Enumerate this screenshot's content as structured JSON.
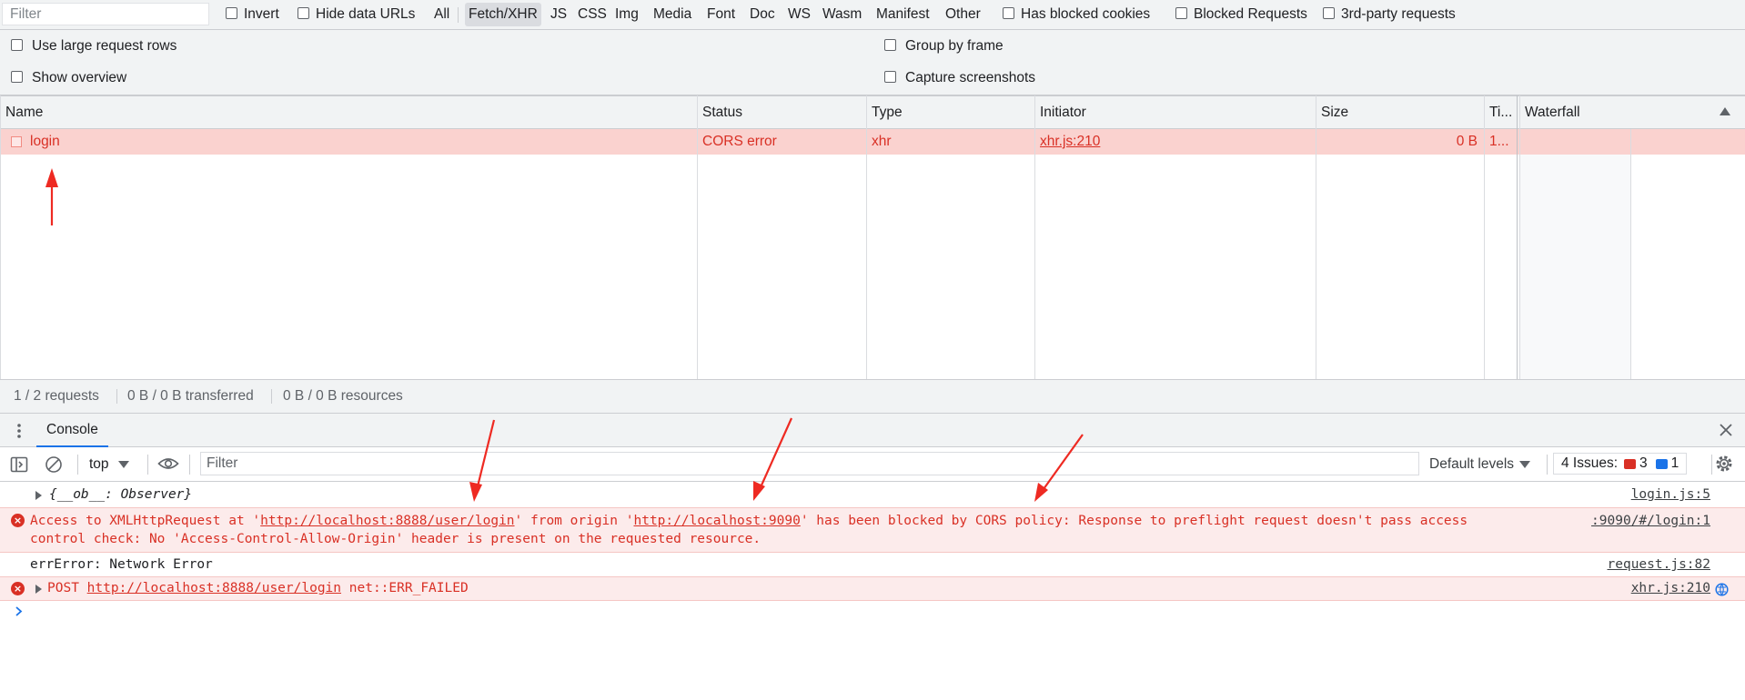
{
  "filter_bar": {
    "filter_placeholder": "Filter",
    "invert": "Invert",
    "hide_data_urls": "Hide data URLs",
    "types": [
      "All",
      "Fetch/XHR",
      "JS",
      "CSS",
      "Img",
      "Media",
      "Font",
      "Doc",
      "WS",
      "Wasm",
      "Manifest",
      "Other"
    ],
    "selected_type": "Fetch/XHR",
    "has_blocked_cookies": "Has blocked cookies",
    "blocked_requests": "Blocked Requests",
    "third_party": "3rd-party requests"
  },
  "settings": {
    "large_rows": "Use large request rows",
    "show_overview": "Show overview",
    "group_by_frame": "Group by frame",
    "capture_screenshots": "Capture screenshots"
  },
  "table": {
    "columns": [
      "Name",
      "Status",
      "Type",
      "Initiator",
      "Size",
      "Ti...",
      "Waterfall"
    ],
    "rows": [
      {
        "name": "login",
        "status": "CORS error",
        "type": "xhr",
        "initiator": "xhr.js:210",
        "size": "0 B",
        "time": "1..."
      }
    ]
  },
  "summary": {
    "requests": "1 / 2 requests",
    "transferred": "0 B / 0 B transferred",
    "resources": "0 B / 0 B resources"
  },
  "console": {
    "tab_label": "Console",
    "context": "top",
    "filter_placeholder": "Filter",
    "levels": "Default levels",
    "issues_label": "4 Issues:",
    "issues_errors": "3",
    "issues_info": "1",
    "messages": {
      "observer": {
        "text": "{__ob__: Observer}",
        "source": "login.js:5"
      },
      "cors": {
        "p1": "Access to XMLHttpRequest at '",
        "url1": "http://localhost:8888/user/login",
        "p2": "' from origin '",
        "url2": "http://localhost:9090",
        "p3": "' has been blocked by CORS policy: Response to preflight request doesn't pass access",
        "line2": "control check: No 'Access-Control-Allow-Origin' header is present on the requested resource.",
        "source": ":9090/#/login:1"
      },
      "err": {
        "text": "errError: Network Error",
        "source": "request.js:82"
      },
      "post": {
        "method": "POST",
        "url": "http://localhost:8888/user/login",
        "error": "net::ERR_FAILED",
        "source": "xhr.js:210"
      }
    }
  },
  "colors": {
    "error": "#d93025",
    "selected_row": "#fad2cf",
    "arrow": "#ee2a22",
    "link_blue": "#1a73e8"
  }
}
